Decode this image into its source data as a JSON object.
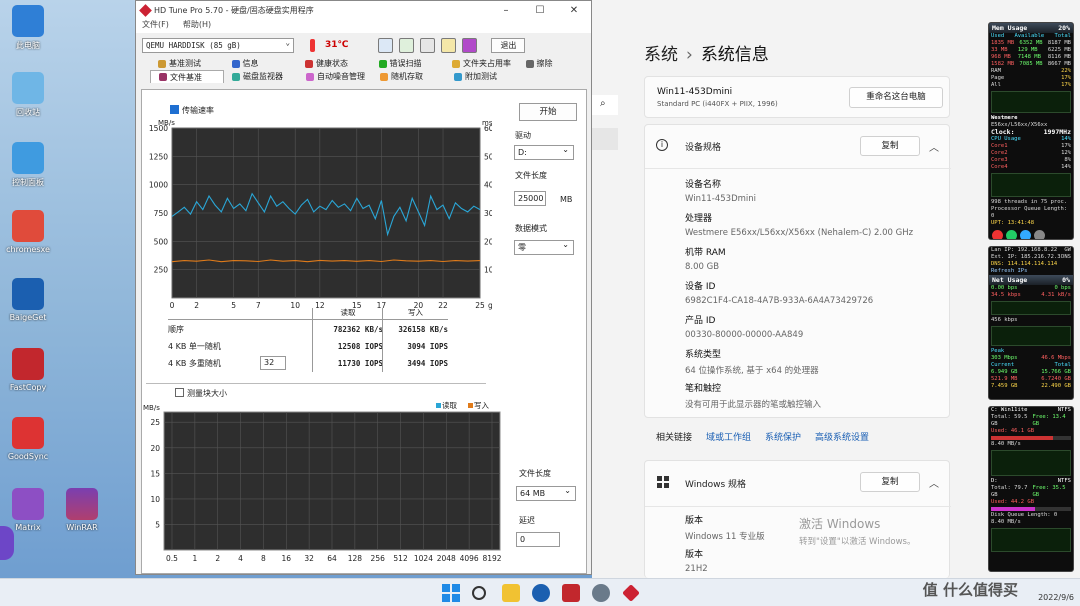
{
  "desktop": {
    "icons": [
      {
        "label": "此电脑",
        "color": "#2f7fd6",
        "top": 5
      },
      {
        "label": "回收站",
        "color": "#6fb6e6",
        "top": 72
      },
      {
        "label": "控制面板",
        "color": "#3f9be0",
        "top": 142
      },
      {
        "label": "chromesxe",
        "color": "#e04b3b",
        "top": 210
      },
      {
        "label": "BaigeGet",
        "color": "#1b5fb0",
        "top": 278
      },
      {
        "label": "FastCopy",
        "color": "#c2272d",
        "top": 348
      },
      {
        "label": "GoodSync",
        "color": "#d33",
        "top": 417
      },
      {
        "label": "Matrix",
        "color": "#8d4fc4",
        "top": 488
      }
    ],
    "winrar_label": "WinRAR"
  },
  "hdtune": {
    "title": "HD Tune Pro 5.70 - 硬盘/固态硬盘实用程序",
    "menu": [
      "文件(F)",
      "帮助(H)"
    ],
    "drive": "QEMU HARDDISK (85 gB)",
    "temperature": "31℃",
    "exit_label": "退出",
    "tabs_row1": [
      "基准测试",
      "信息",
      "健康状态",
      "错误扫描",
      "文件夹占用率",
      "擦除"
    ],
    "tabs_row2": [
      "文件基准",
      "磁盘监视器",
      "自动噪音管理",
      "随机存取",
      "附加测试"
    ],
    "active_tab": "文件基准",
    "transfer_checkbox": "传输速率",
    "start_label": "开始",
    "drive_label": "驱动",
    "drive_value": "D:",
    "file_length_label": "文件长度",
    "file_length_value": "25000",
    "file_length_unit": "MB",
    "data_mode_label": "数据模式",
    "data_mode_value": "零",
    "block_checkbox": "测量块大小",
    "file_length_label2": "文件长度",
    "file_length_value2": "64 MB",
    "delay_label": "延迟",
    "delay_value": "0",
    "queue_depth": "32",
    "results": {
      "head_read": "读取",
      "head_write": "写入",
      "rows": [
        {
          "label": "顺序",
          "read": "782362 KB/s",
          "write": "326158 KB/s"
        },
        {
          "label": "4 KB 单一随机",
          "read": "12508 IOPS",
          "write": "3094 IOPS"
        },
        {
          "label": "4 KB 多重随机",
          "read": "11730 IOPS",
          "write": "3494 IOPS"
        }
      ]
    }
  },
  "chart_data": [
    {
      "type": "line",
      "title": "",
      "xlabel": "",
      "ylabel": "MB/s",
      "y2label": "ms",
      "xunit": "gB",
      "xticks": [
        0,
        2,
        5,
        7,
        10,
        12,
        15,
        17,
        20,
        22,
        25
      ],
      "yticks": [
        250,
        500,
        750,
        1000,
        1250,
        1500
      ],
      "y2ticks": [
        10,
        20,
        30,
        40,
        50,
        60
      ],
      "xlim": [
        0,
        25
      ],
      "ylim": [
        0,
        1500
      ],
      "y2lim": [
        0,
        60
      ],
      "series": [
        {
          "name": "",
          "color": "#2aa6d6",
          "x": [
            0,
            0.5,
            1,
            1.5,
            2,
            2.5,
            3,
            3.5,
            4,
            4.5,
            5,
            5.5,
            6,
            6.5,
            7,
            7.5,
            8,
            8.5,
            9,
            9.5,
            10,
            10.5,
            11,
            11.5,
            12,
            12.5,
            13,
            13.5,
            14,
            14.5,
            15,
            15.5,
            16,
            16.5,
            17,
            17.5,
            18,
            18.5,
            19,
            19.5,
            20,
            20.5,
            21,
            21.5,
            22,
            22.5,
            23,
            23.5,
            24,
            24.5,
            25
          ],
          "y": [
            720,
            760,
            800,
            740,
            850,
            780,
            900,
            820,
            760,
            880,
            790,
            830,
            770,
            920,
            840,
            760,
            900,
            810,
            850,
            790,
            740,
            820,
            870,
            760,
            810,
            780,
            860,
            800,
            830,
            770,
            880,
            790,
            820,
            700,
            860,
            560,
            720,
            800,
            680,
            880,
            760,
            640,
            900,
            780,
            820,
            700,
            840,
            790,
            760,
            810,
            780
          ]
        },
        {
          "name": "",
          "color": "#e07b1a",
          "x": [
            0,
            1,
            2,
            3,
            4,
            5,
            6,
            7,
            8,
            9,
            10,
            11,
            12,
            13,
            14,
            15,
            16,
            17,
            18,
            19,
            20,
            21,
            22,
            23,
            24,
            25
          ],
          "y": [
            320,
            330,
            325,
            335,
            320,
            330,
            328,
            322,
            335,
            325,
            330,
            320,
            332,
            326,
            330,
            324,
            330,
            322,
            335,
            328,
            325,
            330,
            322,
            330,
            326,
            330
          ]
        }
      ]
    },
    {
      "type": "bar",
      "title": "",
      "ylabel": "MB/s",
      "categories": [
        "0.5",
        "1",
        "2",
        "4",
        "8",
        "16",
        "32",
        "64",
        "128",
        "256",
        "512",
        "1024",
        "2048",
        "4096",
        "8192"
      ],
      "yticks": [
        5,
        10,
        15,
        20,
        25
      ],
      "ylim": [
        0,
        27
      ],
      "legend": [
        "读取",
        "写入"
      ],
      "legend_colors": [
        "#2aa6d6",
        "#e07b1a"
      ],
      "series": [
        {
          "name": "读取",
          "values": []
        },
        {
          "name": "写入",
          "values": []
        }
      ]
    }
  ],
  "settings": {
    "crumb_parent": "系统",
    "crumb_sep": "›",
    "crumb_current": "系统信息",
    "pc_name": "Win11-453Dmini",
    "pc_model": "Standard PC (i440FX + PIIX, 1996)",
    "rename_label": "重命名这台电脑",
    "device_spec_title": "设备规格",
    "copy_label": "复制",
    "specs": [
      {
        "label": "设备名称",
        "value": "Win11-453Dmini"
      },
      {
        "label": "处理器",
        "value": "Westmere E56xx/L56xx/X56xx (Nehalem-C)   2.00 GHz"
      },
      {
        "label": "机带 RAM",
        "value": "8.00 GB"
      },
      {
        "label": "设备 ID",
        "value": "6982C1F4-CA18-4A7B-933A-6A4A73429726"
      },
      {
        "label": "产品 ID",
        "value": "00330-80000-00000-AA849"
      },
      {
        "label": "系统类型",
        "value": "64 位操作系统, 基于 x64 的处理器"
      },
      {
        "label": "笔和触控",
        "value": "没有可用于此显示器的笔或触控输入"
      }
    ],
    "related_links_label": "相关链接",
    "related_links": [
      "域或工作组",
      "系统保护",
      "高级系统设置"
    ],
    "windows_spec_title": "Windows 规格",
    "win_specs": [
      {
        "label": "版本",
        "value": "Windows 11 专业版"
      },
      {
        "label": "版本",
        "value": "21H2"
      }
    ],
    "activate_line1": "激活 Windows",
    "activate_line2": "转到\"设置\"以激活 Windows。"
  },
  "gadgets": {
    "mem": {
      "title": "Mem Usage",
      "pct": "20%",
      "cols": [
        "Used",
        "Available",
        "Total"
      ],
      "rows": [
        [
          "1835 MB",
          "6352 MB",
          "8187 MB"
        ],
        [
          "33 MB",
          "129 MB",
          "6225 MB"
        ],
        [
          "968 MB",
          "7148 MB",
          "8116 MB"
        ],
        [
          "1582 MB",
          "7085 MB",
          "8667 MB"
        ]
      ],
      "labels": [
        "RAM",
        "Page",
        "All"
      ],
      "label_vals": [
        "22%",
        "17%",
        "17%"
      ]
    },
    "cpu": {
      "name": "Westmere",
      "model": "E56xx/L56xx/X56xx",
      "clock_label": "Clock:",
      "clock": "1997MHz",
      "usage_label": "CPU Usage",
      "usage": "14%",
      "cores": [
        [
          "Core1",
          "17%"
        ],
        [
          "Core2",
          "12%"
        ],
        [
          "Core3",
          "8%"
        ],
        [
          "Core4",
          "14%"
        ]
      ],
      "threads": "998 threads in 75 proc.",
      "queue": "Processor Queue Length: 0",
      "upt_label": "UPT:",
      "upt": "13:41:48"
    },
    "net": {
      "lan": "Lan IP: 192.168.8.22",
      "gw": "GW",
      "ext": "Ext. IP: 185.216.72.3",
      "ext_flag": "DNS",
      "dns": "DNS: 114.114.114.114",
      "refresh": "Refresh IPs",
      "title": "Net Usage",
      "pct": "0%",
      "up": "0.00 bps",
      "dn": "34.5 kbps",
      "up_r": "0 bps",
      "dn_r": "4.31 kB/s",
      "peak_label": "Peak",
      "peak_up": "303 Mbps",
      "peak_dn": "46.6 Mbps",
      "cur_label": "Current",
      "tot_label": "Total",
      "cur_up": "6.949 GB",
      "cur_dn": "15.766 GB",
      "tot_up": "521.9 MB",
      "tot_dn": "6.7240 GB",
      "sum1": "7.459 GB",
      "sum2": "22.490 GB",
      "scale": "456 kbps"
    },
    "disk": {
      "c_title": "C: Win11ite",
      "c_fs": "NTFS",
      "c_total": "Total: 59.5 GB",
      "c_free": "Free: 13.4 GB",
      "c_used": "Used: 46.1 GB",
      "c_speed": "8.40 MB/s",
      "d_title": "D:",
      "d_fs": "NTFS",
      "d_total": "Total: 79.7 GB",
      "d_free": "Free: 35.5 GB",
      "d_used": "Used: 44.2 GB",
      "queue": "Disk Queue Length: 0",
      "d_speed": "8.40 MB/s"
    }
  },
  "taskbar": {
    "date": "2022/9/6",
    "watermark": "值 什么值得买"
  }
}
